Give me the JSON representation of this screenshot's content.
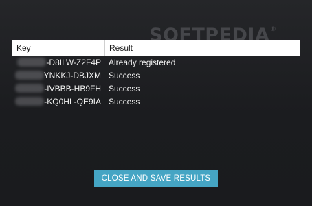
{
  "watermark": {
    "text": "SOFTPEDIA",
    "mark": "®"
  },
  "table": {
    "headers": {
      "key": "Key",
      "result": "Result"
    },
    "rows": [
      {
        "key_visible": "-D8ILW-Z2F4P",
        "result": "Already registered"
      },
      {
        "key_visible": "YNKKJ-DBJXM",
        "result": "Success"
      },
      {
        "key_visible": "-IVBBB-HB9FH",
        "result": "Success"
      },
      {
        "key_visible": "-KQ0HL-QE9IA",
        "result": "Success"
      }
    ]
  },
  "actions": {
    "close_save_label": "CLOSE AND SAVE RESULTS"
  },
  "colors": {
    "background": "#1c1d20",
    "accent": "#45a5c4",
    "header_bg": "#ffffff"
  }
}
